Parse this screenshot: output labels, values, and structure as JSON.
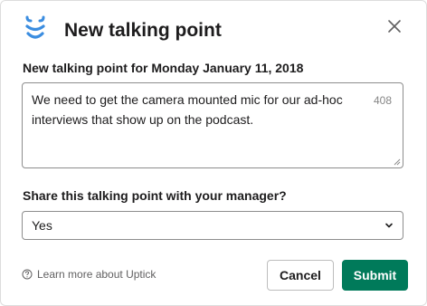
{
  "dialog": {
    "title": "New talking point",
    "close_icon": "close-icon",
    "logo_icon": "uptick-logo-icon"
  },
  "form": {
    "talking_point_label": "New talking point for Monday January 11, 2018",
    "talking_point_value": "We need to get the camera mounted mic for our ad-hoc interviews that show up on the podcast.",
    "char_count": "408",
    "share_label": "Share this talking point with your manager?",
    "share_value": "Yes"
  },
  "footer": {
    "learn_more": "Learn more about Uptick",
    "help_icon": "help-circle-icon",
    "cancel_label": "Cancel",
    "submit_label": "Submit"
  },
  "colors": {
    "accent": "#007a5a",
    "logo": "#3b8de0"
  }
}
